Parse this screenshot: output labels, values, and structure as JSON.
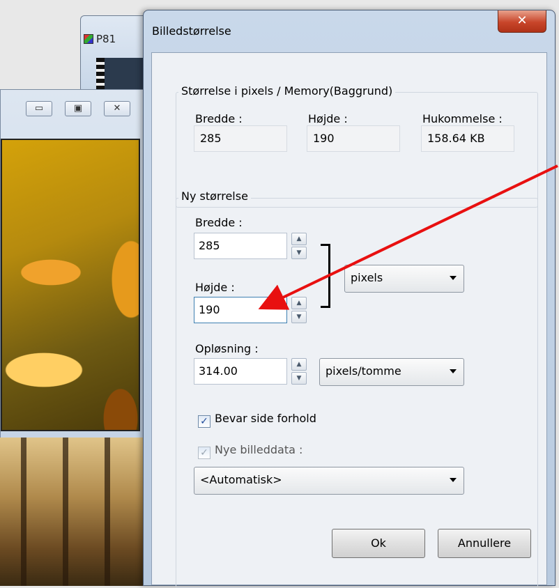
{
  "background": {
    "back_window_title": "P81",
    "controls": {
      "minimize": "▭",
      "maximize": "▣",
      "close": "✕"
    }
  },
  "dialog": {
    "title": "Billedstørrelse",
    "close_label": "✕"
  },
  "current_size": {
    "group_title": "Størrelse i pixels / Memory(Baggrund)",
    "width_label": "Bredde :",
    "height_label": "Højde :",
    "memory_label": "Hukommelse :",
    "width_value": "285",
    "height_value": "190",
    "memory_value": "158.64 KB"
  },
  "new_size": {
    "group_title": "Ny størrelse",
    "width_label": "Bredde :",
    "width_value": "285",
    "height_label": "Højde :",
    "height_value": "190",
    "unit_selected": "pixels",
    "resolution_label": "Opløsning :",
    "resolution_value": "314.00",
    "resolution_unit_selected": "pixels/tomme",
    "keep_aspect_label": "Bevar side forhold",
    "keep_aspect_checked": true,
    "new_image_data_label": "Nye billeddata :",
    "new_image_data_checked": true,
    "resample_selected": "<Automatisk>"
  },
  "buttons": {
    "ok": "Ok",
    "cancel": "Annullere"
  },
  "spin_glyphs": {
    "up": "▲",
    "down": "▼"
  },
  "check_glyph": "✓",
  "annotation_color": "#e81010"
}
